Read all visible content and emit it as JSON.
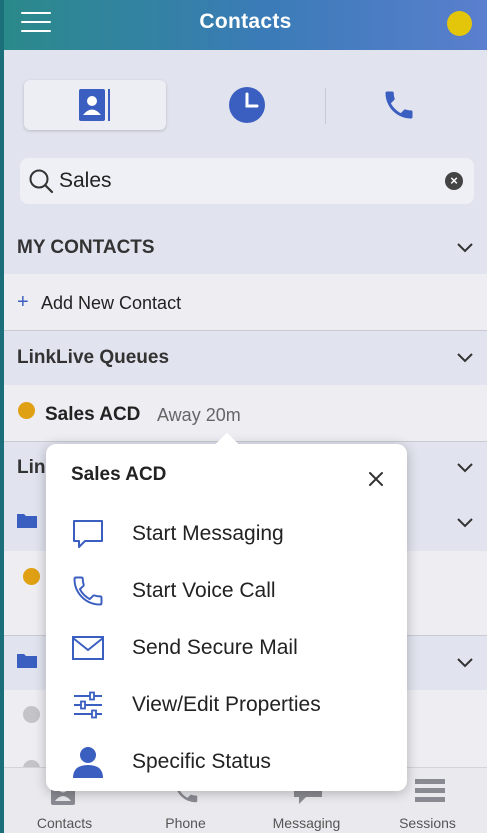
{
  "header": {
    "title": "Contacts",
    "menu_icon": "hamburger-icon",
    "status_color": "#e3c60a"
  },
  "segments": {
    "items": [
      {
        "name": "contacts",
        "icon": "contact-card-icon",
        "selected": true
      },
      {
        "name": "recent",
        "icon": "clock-icon",
        "selected": false
      },
      {
        "name": "dialpad",
        "icon": "phone-icon",
        "selected": false
      }
    ]
  },
  "search": {
    "value": "Sales",
    "icon": "search-icon",
    "clear_label": "×"
  },
  "sections": {
    "my_contacts": "MY CONTACTS",
    "add_new": "Add New Contact",
    "add_plus": "+",
    "queues": "LinkLive Queues",
    "third_partial": "Lin"
  },
  "queue": {
    "name": "Sales ACD",
    "status": "Away 20m",
    "presence_color": "#e0a013"
  },
  "tabbar": {
    "tabs": [
      {
        "label": "Contacts",
        "icon": "contact-card-icon"
      },
      {
        "label": "Phone",
        "icon": "phone-icon"
      },
      {
        "label": "Messaging",
        "icon": "chat-bubble-icon"
      },
      {
        "label": "Sessions",
        "icon": "list-icon"
      }
    ]
  },
  "popover": {
    "title": "Sales ACD",
    "close_label": "×",
    "items": [
      {
        "label": "Start Messaging",
        "icon": "chat-bubble-icon"
      },
      {
        "label": "Start Voice Call",
        "icon": "phone-icon"
      },
      {
        "label": "Send Secure Mail",
        "icon": "mail-icon"
      },
      {
        "label": "View/Edit Properties",
        "icon": "sliders-icon"
      },
      {
        "label": "Specific Status",
        "icon": "person-icon"
      }
    ]
  },
  "colors": {
    "accent": "#3b5fc0",
    "header_start": "#2a8a8a",
    "header_end": "#5a7fce",
    "away": "#e0a013",
    "offline": "#c4c4c8"
  }
}
